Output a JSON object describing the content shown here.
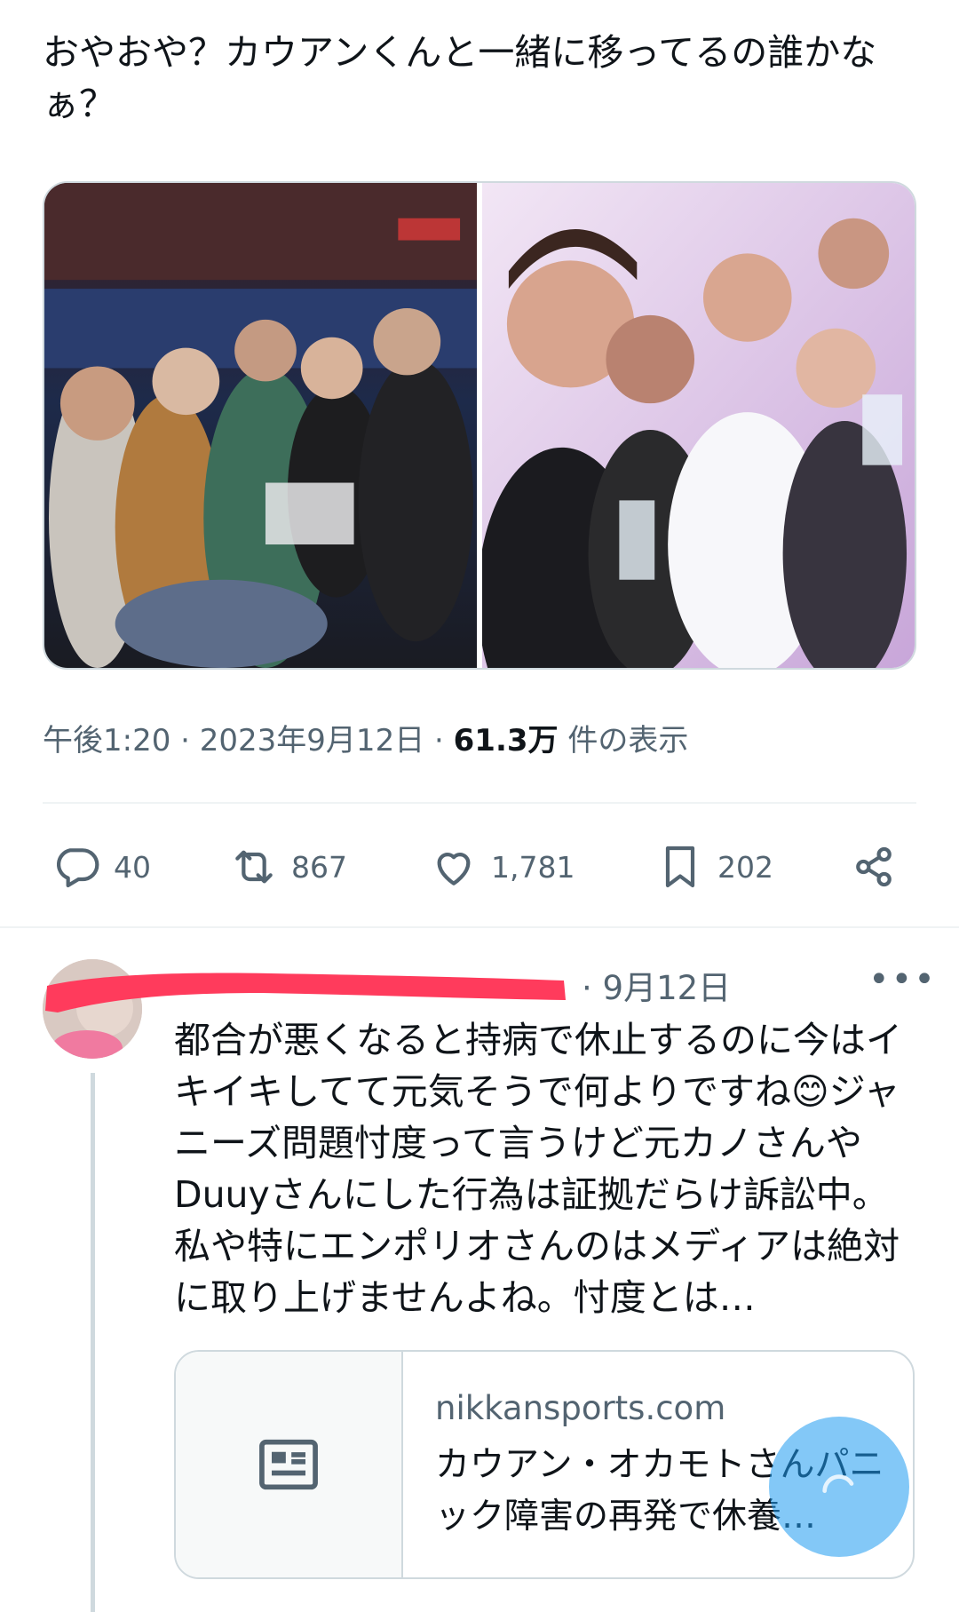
{
  "tweet": {
    "text": "おやおや？カウアンくんと一緒に移ってるの誰かなぁ？",
    "timestamp": "午後1:20 · 2023年9月12日 · ",
    "views_count": "61.3万",
    "views_label": " 件の表示"
  },
  "actions": {
    "replies": "40",
    "retweets": "867",
    "likes": "1,781",
    "bookmarks": "202"
  },
  "reply": {
    "date": "· 9月12日",
    "more": "•••",
    "text": "都合が悪くなると持病で休止するのに今はイキイキしてて元気そうで何よりですね😊ジャニーズ問題忖度って言うけど元カノさんやDuuyさんにした行為は証拠だらけ訴訟中。私や特にエンポリオさんのはメディアは絶対に取り上げませんよね。忖度とは…",
    "card": {
      "domain": "nikkansports.com",
      "title": "カウアン・オカモトさんパニック障害の再発で休養…"
    }
  },
  "colors": {
    "text_primary": "#0f1419",
    "text_secondary": "#536471",
    "border": "#cfd9de",
    "accent": "#1d9bf0",
    "redaction": "#ff3b5c"
  },
  "icons": [
    "reply-icon",
    "retweet-icon",
    "like-icon",
    "bookmark-icon",
    "share-icon",
    "article-icon"
  ]
}
